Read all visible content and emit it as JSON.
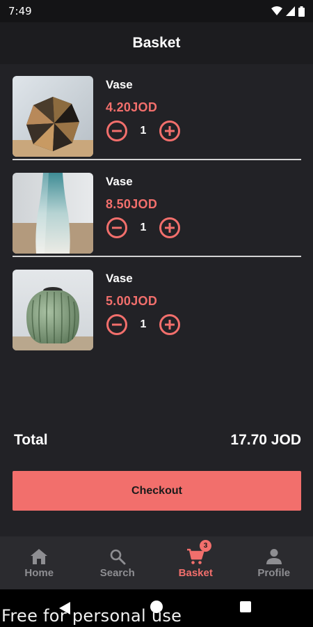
{
  "status": {
    "time": "7:49"
  },
  "header": {
    "title": "Basket"
  },
  "items": [
    {
      "name": "Vase",
      "price": "4.20JOD",
      "quantity": "1"
    },
    {
      "name": "Vase",
      "price": "8.50JOD",
      "quantity": "1"
    },
    {
      "name": "Vase",
      "price": "5.00JOD",
      "quantity": "1"
    }
  ],
  "summary": {
    "total_label": "Total",
    "total_value": "17.70 JOD"
  },
  "checkout": {
    "label": "Checkout"
  },
  "nav": {
    "home": "Home",
    "search": "Search",
    "basket": "Basket",
    "basket_badge": "3",
    "profile": "Profile"
  },
  "watermark": "Free for personal use",
  "colors": {
    "accent": "#f26f6c",
    "background": "#222226",
    "nav_bg": "#2b2b2f"
  }
}
